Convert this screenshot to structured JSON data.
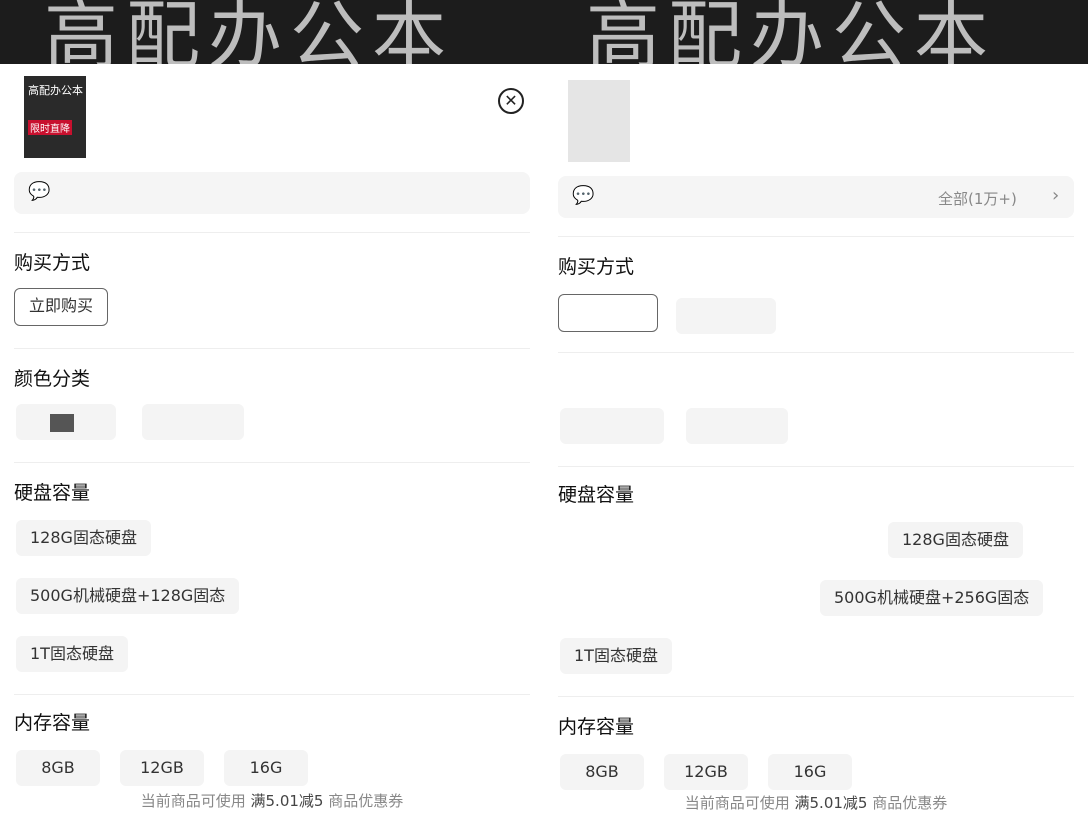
{
  "left": {
    "banner": "高配办公本",
    "thumb": {
      "title": "高配办公本",
      "badge": "限时直降"
    },
    "close_glyph": "✕",
    "sections": {
      "purchase": "购买方式",
      "color": "颜色分类",
      "disk": "硬盘容量",
      "memory": "内存容量"
    },
    "purchase_options": [
      "立即购买"
    ],
    "disk_options": [
      "128G固态硬盘",
      "500G机械硬盘+128G固态",
      "1T固态硬盘"
    ],
    "memory_options": [
      "8GB",
      "12GB",
      "16G"
    ],
    "coupon": {
      "prefix": "当前商品可使用",
      "offer": "满5.01减5",
      "suffix": "商品优惠券"
    }
  },
  "right": {
    "banner": "高配办公本",
    "review_all": "全部(1万+)",
    "sections": {
      "purchase": "购买方式",
      "disk": "硬盘容量",
      "memory": "内存容量"
    },
    "disk_options": [
      "128G固态硬盘",
      "1T固态硬盘",
      "500G机械硬盘+256G固态"
    ],
    "memory_options": [
      "8GB",
      "12GB",
      "16G"
    ],
    "coupon": {
      "prefix": "当前商品可使用",
      "offer": "满5.01减5",
      "suffix": "商品优惠券"
    }
  },
  "icons": {
    "review": "chat-bubble-icon",
    "close": "close-circle-icon",
    "chevron": "chevron-right-icon"
  }
}
